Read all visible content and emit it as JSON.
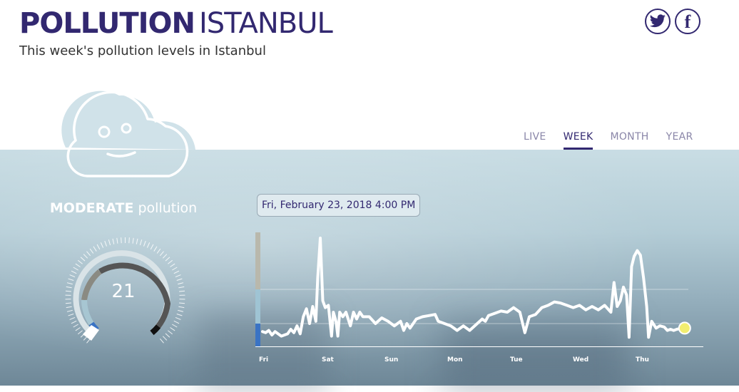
{
  "header": {
    "title_strong": "POLLUTION",
    "title_light": "ISTANBUL",
    "subtitle": "This week's pollution levels in Istanbul"
  },
  "social": [
    {
      "icon": "twitter-icon"
    },
    {
      "icon": "facebook-icon",
      "glyph": "f"
    }
  ],
  "tabs": [
    {
      "label": "LIVE",
      "active": false
    },
    {
      "label": "WEEK",
      "active": true
    },
    {
      "label": "MONTH",
      "active": false
    },
    {
      "label": "YEAR",
      "active": false
    }
  ],
  "status": {
    "level": "MODERATE",
    "suffix": "pollution",
    "value": "21"
  },
  "tooltip": "Fri, February 23, 2018 4:00 PM",
  "colors": {
    "brand": "#322870",
    "line": "#ffffff",
    "marker": "#f2ee70",
    "low": "#3a73c4",
    "moderate": "#9fc4d4",
    "high": "#b9b8ac"
  },
  "chart_data": {
    "type": "line",
    "x": [
      "Fri",
      "Sat",
      "Sun",
      "Mon",
      "Tue",
      "Wed",
      "Thu"
    ],
    "values": [
      [
        0.0,
        13
      ],
      [
        0.05,
        12
      ],
      [
        0.1,
        14
      ],
      [
        0.15,
        10
      ],
      [
        0.2,
        13
      ],
      [
        0.3,
        9
      ],
      [
        0.4,
        11
      ],
      [
        0.45,
        15
      ],
      [
        0.5,
        12
      ],
      [
        0.55,
        18
      ],
      [
        0.6,
        11
      ],
      [
        0.65,
        26
      ],
      [
        0.7,
        33
      ],
      [
        0.75,
        20
      ],
      [
        0.8,
        35
      ],
      [
        0.85,
        22
      ],
      [
        0.88,
        60
      ],
      [
        0.92,
        95
      ],
      [
        0.96,
        40
      ],
      [
        1.0,
        34
      ],
      [
        1.05,
        36
      ],
      [
        1.08,
        20
      ],
      [
        1.1,
        9
      ],
      [
        1.13,
        30
      ],
      [
        1.17,
        22
      ],
      [
        1.2,
        9
      ],
      [
        1.23,
        30
      ],
      [
        1.28,
        26
      ],
      [
        1.33,
        30
      ],
      [
        1.4,
        18
      ],
      [
        1.45,
        30
      ],
      [
        1.5,
        24
      ],
      [
        1.55,
        30
      ],
      [
        1.6,
        26
      ],
      [
        1.7,
        26
      ],
      [
        1.8,
        20
      ],
      [
        1.9,
        25
      ],
      [
        2.0,
        22
      ],
      [
        2.1,
        18
      ],
      [
        2.2,
        22
      ],
      [
        2.25,
        14
      ],
      [
        2.3,
        20
      ],
      [
        2.35,
        16
      ],
      [
        2.45,
        24
      ],
      [
        2.55,
        26
      ],
      [
        2.65,
        27
      ],
      [
        2.75,
        28
      ],
      [
        2.8,
        22
      ],
      [
        2.9,
        20
      ],
      [
        3.0,
        18
      ],
      [
        3.1,
        14
      ],
      [
        3.2,
        18
      ],
      [
        3.3,
        14
      ],
      [
        3.4,
        19
      ],
      [
        3.5,
        24
      ],
      [
        3.55,
        22
      ],
      [
        3.6,
        27
      ],
      [
        3.7,
        29
      ],
      [
        3.8,
        31
      ],
      [
        3.9,
        30
      ],
      [
        4.0,
        34
      ],
      [
        4.1,
        30
      ],
      [
        4.18,
        12
      ],
      [
        4.25,
        26
      ],
      [
        4.35,
        28
      ],
      [
        4.45,
        34
      ],
      [
        4.55,
        36
      ],
      [
        4.65,
        39
      ],
      [
        4.75,
        38
      ],
      [
        4.85,
        36
      ],
      [
        4.95,
        34
      ],
      [
        5.05,
        36
      ],
      [
        5.15,
        32
      ],
      [
        5.25,
        35
      ],
      [
        5.35,
        32
      ],
      [
        5.45,
        36
      ],
      [
        5.55,
        30
      ],
      [
        5.6,
        56
      ],
      [
        5.65,
        35
      ],
      [
        5.7,
        40
      ],
      [
        5.75,
        52
      ],
      [
        5.8,
        45
      ],
      [
        5.84,
        8
      ],
      [
        5.88,
        70
      ],
      [
        5.92,
        79
      ],
      [
        5.97,
        84
      ],
      [
        6.02,
        80
      ],
      [
        6.07,
        60
      ],
      [
        6.12,
        35
      ],
      [
        6.15,
        8
      ],
      [
        6.2,
        22
      ],
      [
        6.27,
        16
      ],
      [
        6.33,
        18
      ],
      [
        6.4,
        17
      ],
      [
        6.45,
        14
      ],
      [
        6.5,
        15
      ],
      [
        6.55,
        14
      ],
      [
        6.6,
        15
      ],
      [
        6.68,
        16
      ]
    ],
    "highlight_value": 21,
    "ylim": [
      0,
      100
    ]
  }
}
